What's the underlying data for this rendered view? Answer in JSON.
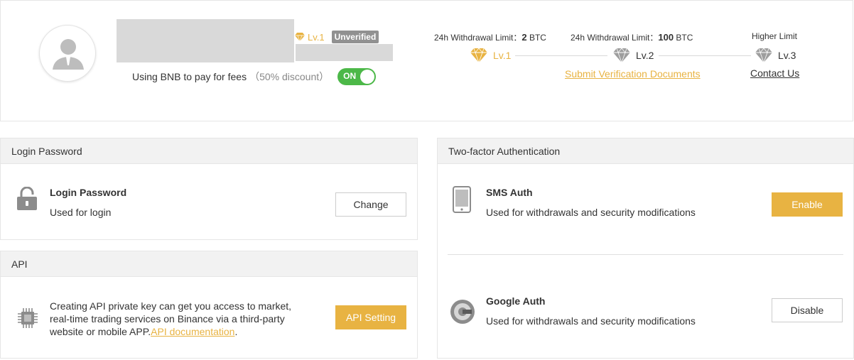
{
  "profile": {
    "level": "Lv.1",
    "status_badge": "Unverified",
    "bnb_fees_label": "Using BNB to pay for fees",
    "bnb_discount": "（50% discount）",
    "toggle_label": "ON"
  },
  "limits": {
    "lv1_prefix": "24h Withdrawal Limit：",
    "lv1_amount": "2",
    "lv1_unit": " BTC",
    "lv2_prefix": "24h Withdrawal Limit：",
    "lv2_amount": "100",
    "lv2_unit": " BTC",
    "lv3_label": "Higher Limit",
    "step1": "Lv.1",
    "step2": "Lv.2",
    "step3": "Lv.3",
    "submit_link": "Submit Verification Documents",
    "contact_link": "Contact Us"
  },
  "login": {
    "header": "Login Password",
    "title": "Login Password",
    "desc": "Used for login",
    "button": "Change"
  },
  "api": {
    "header": "API",
    "desc_main": "Creating API private key can get you access to market, real-time trading services on Binance via a third-party website or mobile APP.",
    "doc_link": "API documentation",
    "desc_end": ".",
    "button": "API Setting"
  },
  "tfa": {
    "header": "Two-factor Authentication",
    "sms_title": "SMS Auth",
    "sms_desc": "Used for withdrawals and security modifications",
    "sms_button": "Enable",
    "google_title": "Google Auth",
    "google_desc": "Used for withdrawals and security modifications",
    "google_button": "Disable"
  },
  "colors": {
    "accent_gold": "#e8b342",
    "toggle_green": "#4cb848",
    "badge_gray": "#919191"
  },
  "icons": {
    "avatar": "user-avatar-icon",
    "diamond": "diamond-icon",
    "lock": "lock-icon",
    "chip": "chip-icon",
    "phone": "phone-icon",
    "google_auth": "google-authenticator-icon"
  }
}
